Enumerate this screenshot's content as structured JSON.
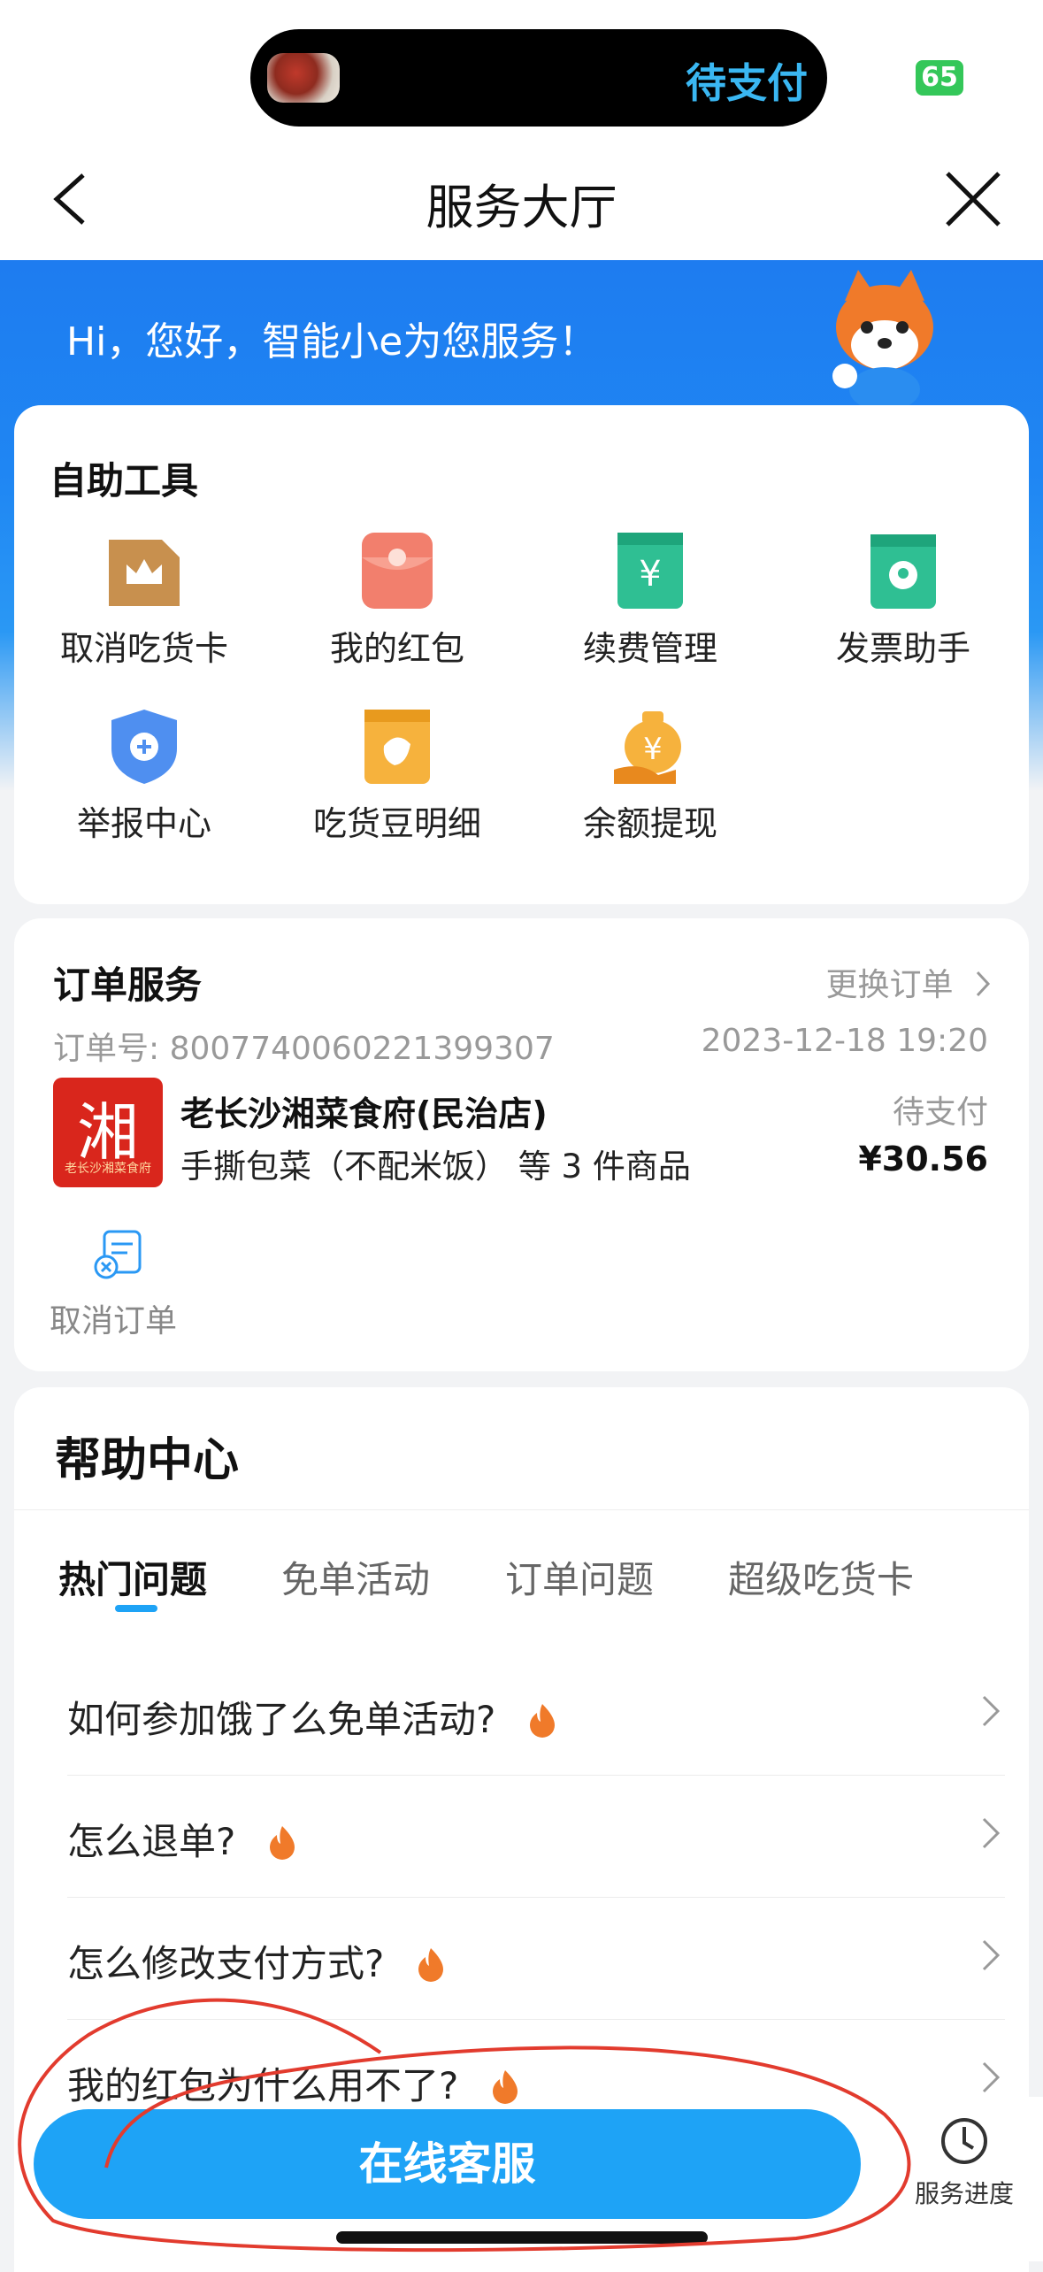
{
  "status_bar": {
    "island_text": "待支付",
    "battery": "65"
  },
  "nav": {
    "title": "服务大厅"
  },
  "header": {
    "greeting": "Hi，您好，智能小e为您服务！"
  },
  "tools": {
    "title": "自助工具",
    "items": [
      {
        "label": "取消吃货卡",
        "icon": "crown-card-icon",
        "color": "#c8904e"
      },
      {
        "label": "我的红包",
        "icon": "red-envelope-icon",
        "color": "#f27f6d"
      },
      {
        "label": "续费管理",
        "icon": "yen-ticket-icon",
        "color": "#2fbf93"
      },
      {
        "label": "发票助手",
        "icon": "invoice-icon",
        "color": "#2fbf93"
      },
      {
        "label": "举报中心",
        "icon": "shield-plus-icon",
        "color": "#4f8ff0"
      },
      {
        "label": "吃货豆明细",
        "icon": "bean-card-icon",
        "color": "#f6b23d"
      },
      {
        "label": "余额提现",
        "icon": "money-bag-icon",
        "color": "#f6a531"
      }
    ]
  },
  "order": {
    "title": "订单服务",
    "change_label": "更换订单",
    "order_no": "订单号: 8007740060221399307",
    "datetime": "2023-12-18 19:20",
    "store_name": "老长沙湘菜食府(民治店)",
    "status": "待支付",
    "items_desc": "手撕包菜（不配米饭） 等 3 件商品",
    "price": "¥30.56",
    "logo_char": "湘",
    "logo_sub": "老长沙湘菜食府",
    "cancel_label": "取消订单"
  },
  "help": {
    "title": "帮助中心",
    "tabs": [
      "热门问题",
      "免单活动",
      "订单问题",
      "超级吃货卡"
    ],
    "faqs": [
      "如何参加饿了么免单活动?",
      "怎么退单?",
      "怎么修改支付方式?",
      "我的红包为什么用不了?"
    ]
  },
  "bottom": {
    "cs_label": "在线客服",
    "progress_label": "服务进度"
  },
  "colors": {
    "accent": "#1ea3f6",
    "header_blue": "#1e7cf0",
    "annotation": "#e23b2e"
  }
}
